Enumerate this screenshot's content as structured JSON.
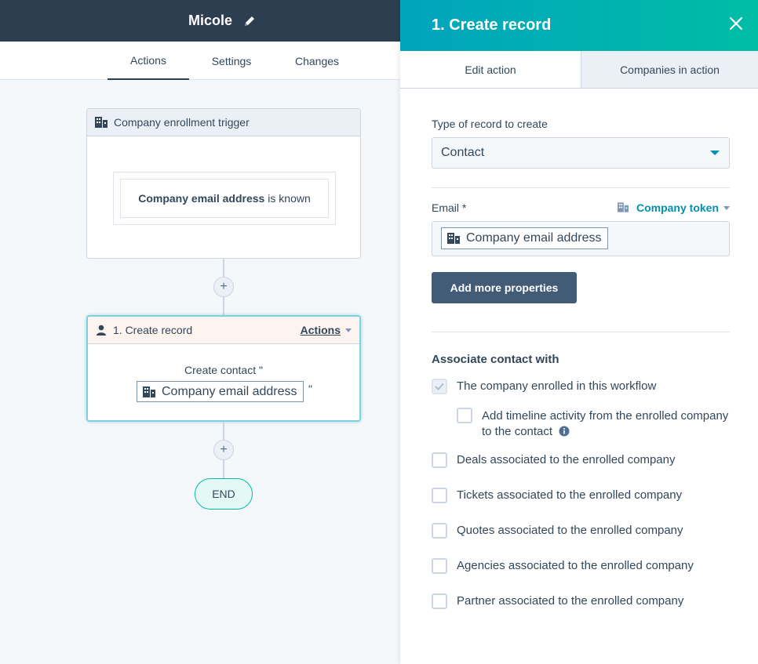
{
  "workflow": {
    "name": "Micole"
  },
  "tabs": [
    {
      "label": "Actions"
    },
    {
      "label": "Settings"
    },
    {
      "label": "Changes"
    }
  ],
  "trigger": {
    "title": "Company enrollment trigger",
    "filter_property": "Company email address",
    "filter_condition": "is known"
  },
  "action_card": {
    "title": "1. Create record",
    "actions_label": "Actions",
    "create_text": "Create contact \"",
    "token_label": "Company email address",
    "closing_quote": "\""
  },
  "end_label": "END",
  "plus_label": "+",
  "panel": {
    "title": "1. Create record",
    "tabs": [
      {
        "label": "Edit action"
      },
      {
        "label": "Companies in action"
      }
    ],
    "record_type_label": "Type of record to create",
    "record_type_value": "Contact",
    "email_label": "Email *",
    "company_token_label": "Company token",
    "email_token": "Company email address",
    "add_more_label": "Add more properties",
    "associate_heading": "Associate contact with",
    "associations": [
      {
        "label": "The company enrolled in this workflow",
        "checked": true
      },
      {
        "label": "Add timeline activity from the enrolled company to the contact",
        "checked": false
      },
      {
        "label": "Deals associated to the enrolled company",
        "checked": false
      },
      {
        "label": "Tickets associated to the enrolled company",
        "checked": false
      },
      {
        "label": "Quotes associated to the enrolled company",
        "checked": false
      },
      {
        "label": "Agencies associated to the enrolled company",
        "checked": false
      },
      {
        "label": "Partner associated to the enrolled company",
        "checked": false
      }
    ]
  },
  "colors": {
    "topbar": "#2d3e50",
    "panel_gradient_start": "#00a4bd",
    "panel_gradient_end": "#00bda5",
    "accent_teal": "#0091ae",
    "button_dark": "#425b76"
  }
}
